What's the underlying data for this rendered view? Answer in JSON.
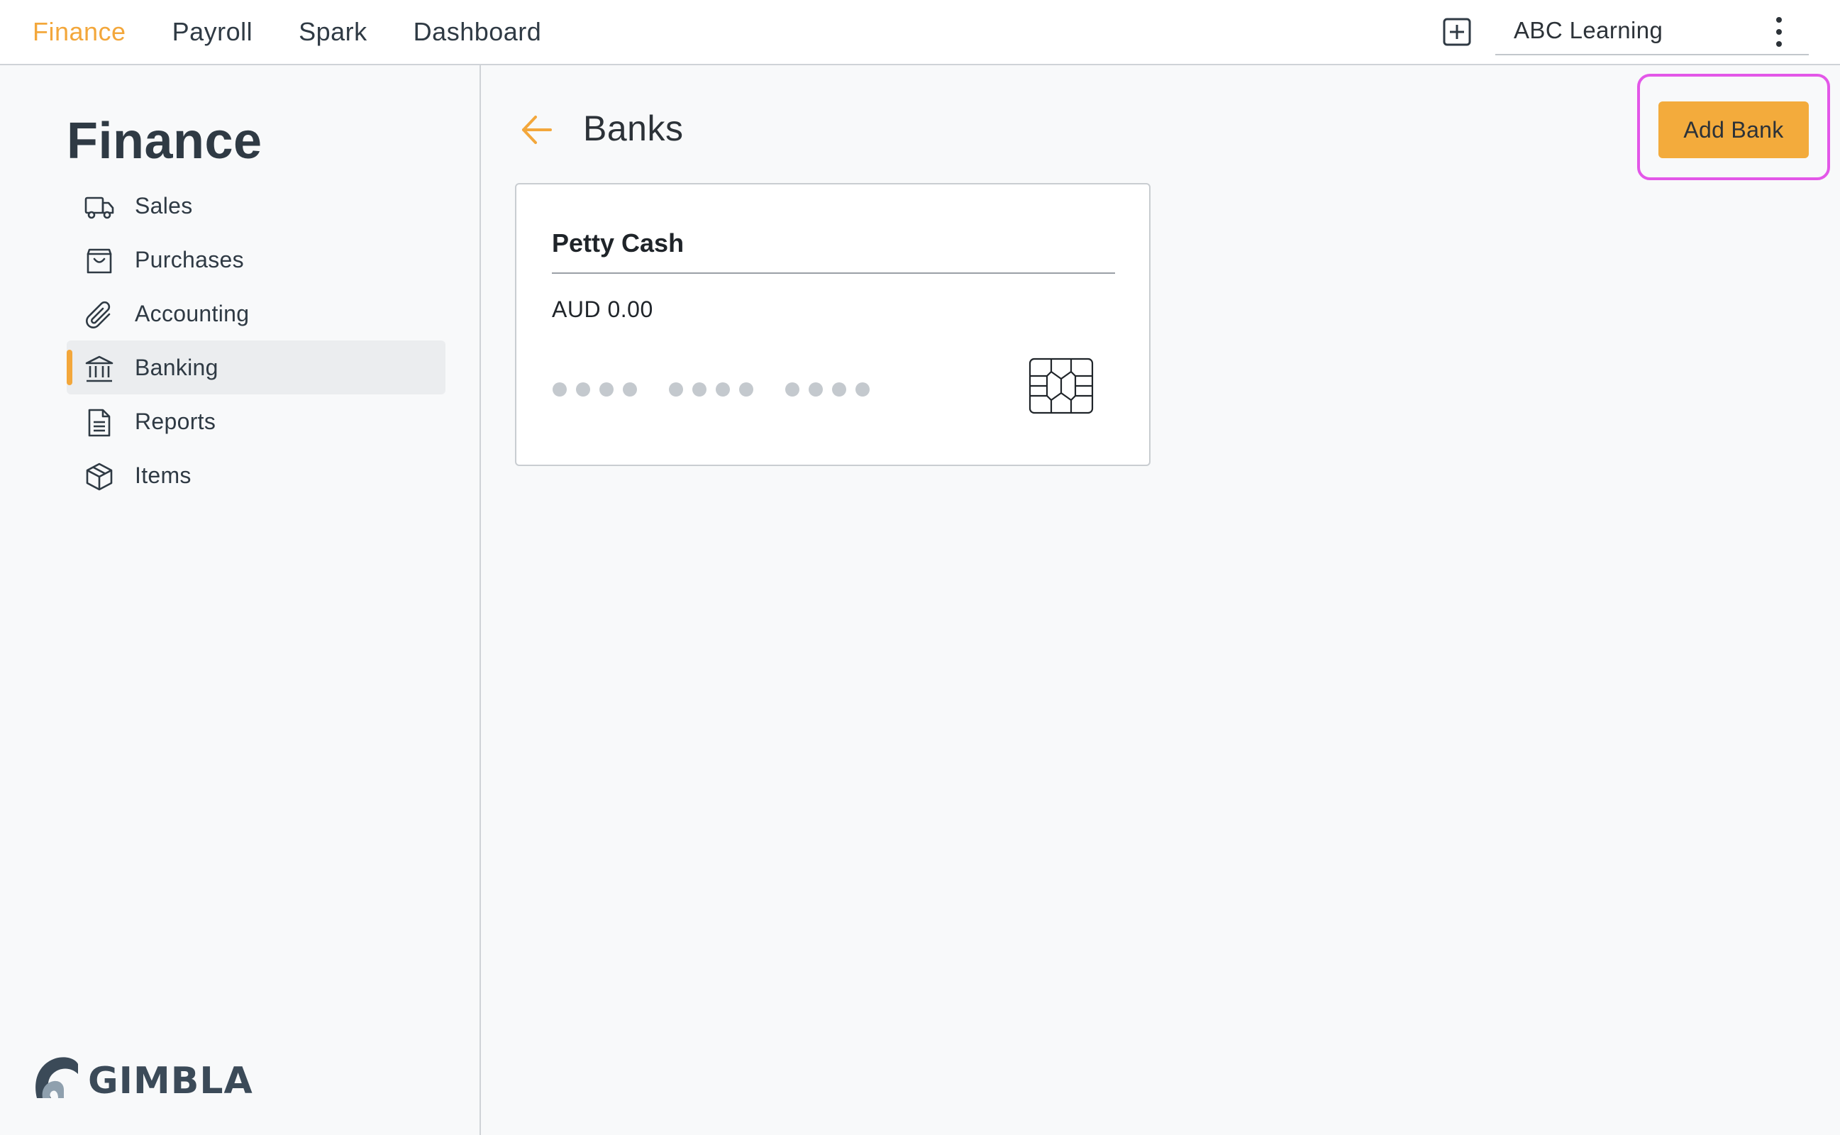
{
  "topnav": {
    "items": [
      {
        "label": "Finance",
        "active": true
      },
      {
        "label": "Payroll",
        "active": false
      },
      {
        "label": "Spark",
        "active": false
      },
      {
        "label": "Dashboard",
        "active": false
      }
    ],
    "add_icon": "plus-square-icon",
    "organization": "ABC Learning",
    "menu_icon": "more-vertical-icon"
  },
  "sidebar": {
    "title": "Finance",
    "items": [
      {
        "label": "Sales",
        "icon": "truck-icon",
        "active": false
      },
      {
        "label": "Purchases",
        "icon": "shopping-bag-icon",
        "active": false
      },
      {
        "label": "Accounting",
        "icon": "paperclip-icon",
        "active": false
      },
      {
        "label": "Banking",
        "icon": "bank-icon",
        "active": true
      },
      {
        "label": "Reports",
        "icon": "document-icon",
        "active": false
      },
      {
        "label": "Items",
        "icon": "box-icon",
        "active": false
      }
    ],
    "logo_text": "GIMBLA"
  },
  "main": {
    "title": "Banks",
    "back_icon": "arrow-left-icon",
    "add_button": "Add Bank",
    "cards": [
      {
        "name": "Petty Cash",
        "balance": "AUD 0.00",
        "masked_number_groups": 3,
        "chip_icon": "card-chip-icon"
      }
    ]
  },
  "colors": {
    "accent": "#f3a73b",
    "highlight_outline": "#e357e8",
    "text": "#2c3238",
    "background": "#f8f9fa"
  }
}
